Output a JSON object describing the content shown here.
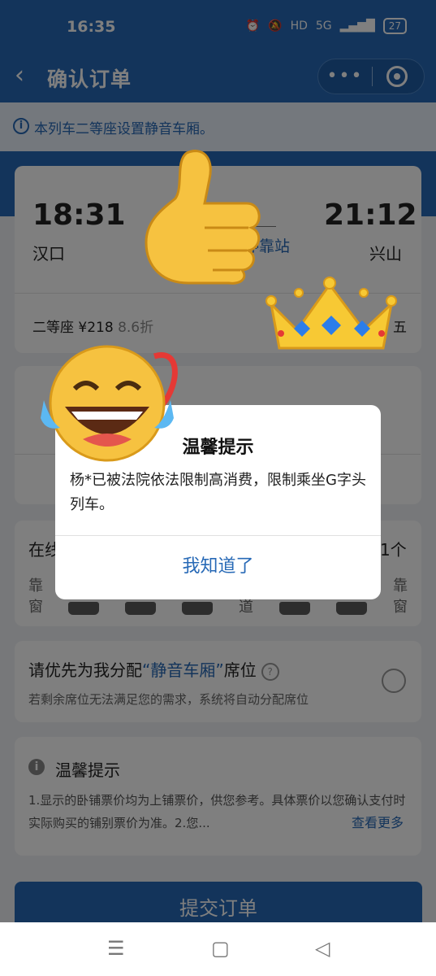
{
  "status_bar": {
    "time": "16:35",
    "network": "5G",
    "hd": "HD",
    "battery": "27"
  },
  "nav": {
    "back_icon": "‹",
    "title": "确认订单"
  },
  "notice": {
    "icon": "i",
    "text": "本列车二等座设置静音车厢。"
  },
  "trip": {
    "depart_time": "18:31",
    "depart_station": "汉口",
    "arrive_time": "21:12",
    "arrive_station": "兴山",
    "stops_link": "停靠站"
  },
  "seat": {
    "class": "二等座",
    "price": "¥218",
    "discount": "8.6折",
    "right_char": "五"
  },
  "online_seat": {
    "title_start": "在线",
    "count_char": "1个",
    "left_label_top": "靠",
    "left_label_bottom": "窗",
    "mid_label": "道",
    "right_label_top": "靠",
    "right_label_bottom": "窗"
  },
  "preference": {
    "prefix": "请优先为我分配",
    "highlight": "“静音车厢”",
    "suffix": "席位",
    "help_icon": "?",
    "subtitle": "若剩余席位无法满足您的需求，系统将自动分配席位"
  },
  "tips": {
    "icon": "i",
    "title": "温馨提示",
    "body": "1.显示的卧铺票价均为上铺票价，供您参考。具体票价以您确认支付时实际购买的铺别票价为准。2.您...",
    "more": "查看更多"
  },
  "submit_button": "提交订单",
  "dialog": {
    "title": "温馨提示",
    "message": "杨*已被法院依法限制高消费，限制乘坐G字头列车。",
    "confirm": "我知道了"
  },
  "system_nav": {
    "menu_icon": "☰",
    "home_icon": "▢",
    "back_icon": "◁"
  },
  "colors": {
    "brand": "#2769b6",
    "overlay": "rgba(0,0,0,0.5)"
  }
}
